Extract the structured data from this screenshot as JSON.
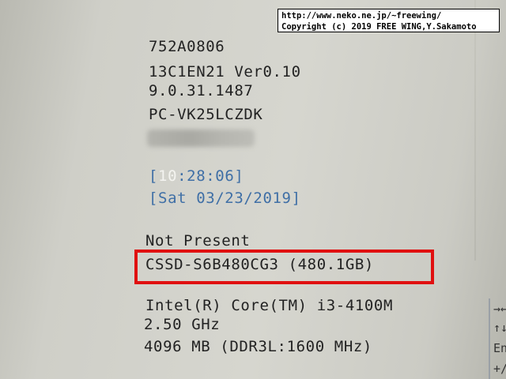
{
  "watermark": {
    "line1": "http://www.neko.ne.jp/~freewing/",
    "line2": "Copyright (c) 2019 FREE WING,Y.Sakamoto"
  },
  "system_info": {
    "line1": "752A0806",
    "line2": "13C1EN21 Ver0.10",
    "line3": "9.0.31.1487",
    "model": "PC-VK25LCZDK"
  },
  "datetime": {
    "time_open": "[",
    "time_hour": "10",
    "time_rest": ":28:06]",
    "date": "[Sat 03/23/2019]"
  },
  "storage": {
    "slot1": "Not Present",
    "slot2": "CSSD-S6B480CG3 (480.1GB)"
  },
  "cpu": {
    "name": "Intel(R) Core(TM) i3-4100M",
    "speed": "2.50 GHz",
    "memory": "4096 MB (DDR3L:1600 MHz)"
  },
  "help": {
    "arrows": "→←",
    "updown": "↑↓",
    "enter": "Ent",
    "plusminus": "+/-"
  }
}
